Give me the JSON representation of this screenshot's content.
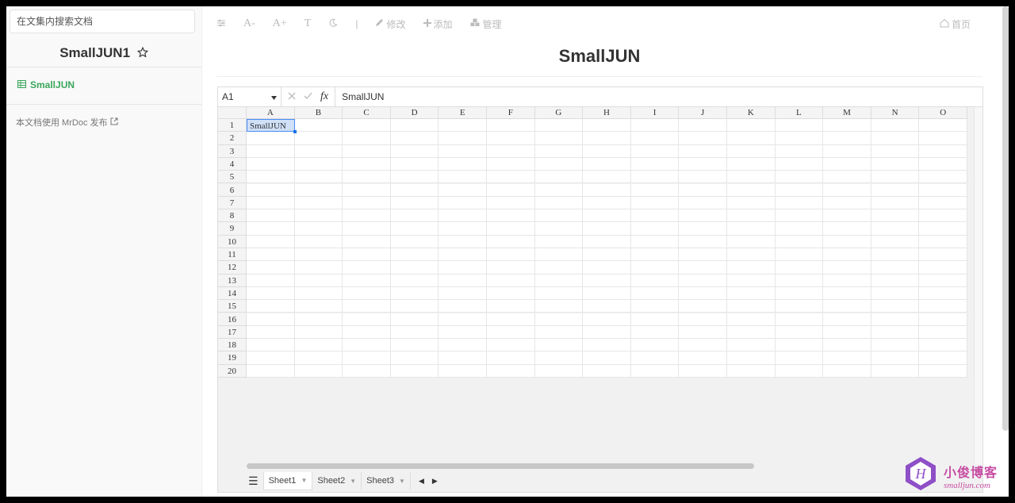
{
  "sidebar": {
    "search_placeholder": "在文集内搜索文档",
    "project_title": "SmallJUN1",
    "doc_item": "SmallJUN",
    "footer_note": "本文档使用 MrDoc 发布"
  },
  "toolbar": {
    "font_minus": "A-",
    "font_plus": "A+",
    "font_type": "T",
    "separator": "|",
    "edit": "修改",
    "add": "添加",
    "manage": "管理",
    "home": "首页"
  },
  "doc": {
    "title": "SmallJUN"
  },
  "sheet": {
    "cell_ref": "A1",
    "formula_value": "SmallJUN",
    "fx_label": "fx",
    "columns": [
      "A",
      "B",
      "C",
      "D",
      "E",
      "F",
      "G",
      "H",
      "I",
      "J",
      "K",
      "L",
      "M",
      "N",
      "O"
    ],
    "rows": [
      "1",
      "2",
      "3",
      "4",
      "5",
      "6",
      "7",
      "8",
      "9",
      "10",
      "11",
      "12",
      "13",
      "14",
      "15",
      "16",
      "17",
      "18",
      "19",
      "20"
    ],
    "a1_value": "SmallJUN",
    "tabs": [
      "Sheet1",
      "Sheet2",
      "Sheet3"
    ],
    "active_tab": "Sheet1"
  },
  "watermark": {
    "cn": "小俊博客",
    "en": "smalljun.com"
  },
  "colors": {
    "accent_green": "#3aa55a",
    "selection_blue": "#4a8af4",
    "watermark_pink": "#c74da3"
  }
}
